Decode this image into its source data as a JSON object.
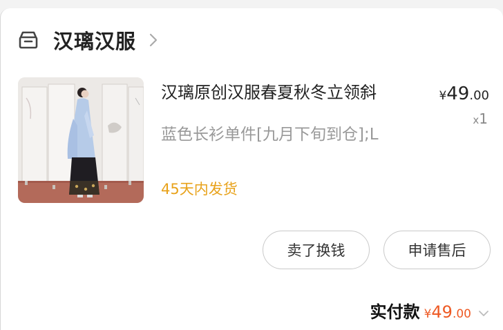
{
  "store": {
    "name": "汉璃汉服",
    "icon": "store-icon",
    "chevron_icon": "chevron-right-icon"
  },
  "product": {
    "title": "汉璃原创汉服春夏秋冬立领斜",
    "spec": "蓝色长衫单件[九月下旬到仓];L",
    "shipping": "45天内发货",
    "price": {
      "currency": "¥",
      "integer": "49",
      "decimal": ".00"
    },
    "quantity": {
      "prefix": "x",
      "value": "1"
    },
    "image": "hanfu-model-photo"
  },
  "actions": {
    "sell_label": "卖了换钱",
    "after_sale_label": "申请售后"
  },
  "total": {
    "label": "实付款",
    "currency": "¥",
    "integer": "49",
    "decimal": ".00",
    "chevron_icon": "chevron-down-icon"
  },
  "colors": {
    "accent": "#ee5a24",
    "shipping": "#e8a21a",
    "muted": "#999999"
  }
}
